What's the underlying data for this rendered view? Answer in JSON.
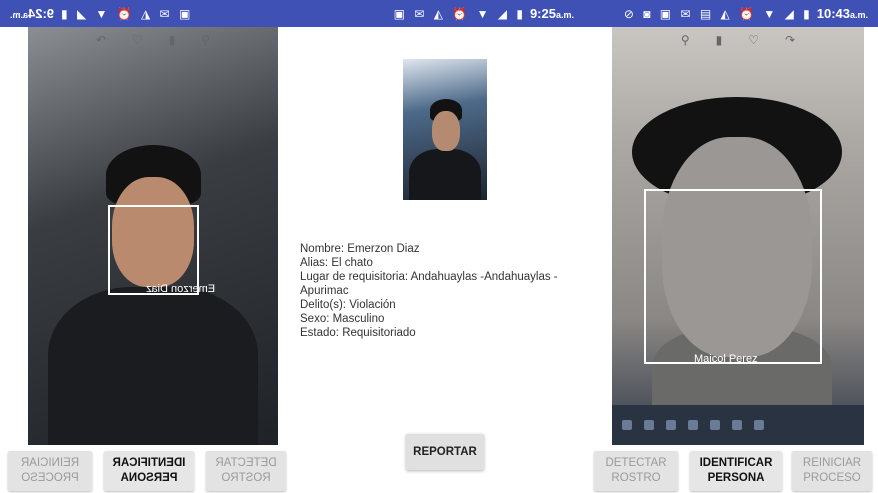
{
  "left_screen": {
    "status": {
      "time": "9:24",
      "ampm": "a.m.",
      "icons": [
        "image-icon",
        "mail-icon",
        "android-icon",
        "alarm-icon",
        "wifi-icon",
        "signal-icon",
        "battery-icon"
      ]
    },
    "camera_tools": [
      "edit-icon",
      "heart-icon",
      "trash-icon",
      "search-icon"
    ],
    "face_label": "Emerzon Diaz",
    "buttons": {
      "restart": "REINICIAR PROCESO",
      "identify": "IDENTIFICAR PERSONA",
      "detect": "DETECTAR ROSTRO"
    }
  },
  "middle_screen": {
    "status": {
      "time": "9:25",
      "ampm": "a.m.",
      "icons": [
        "image-icon",
        "mail-icon",
        "android-icon",
        "alarm-icon",
        "wifi-icon",
        "signal-icon",
        "battery-icon"
      ]
    },
    "info": {
      "nombre": "Nombre: Emerzon Diaz",
      "alias": "Alias: El chato",
      "lugar": "Lugar de requisitoria: Andahuaylas -Andahuaylas - Apurimac",
      "delito": "Delito(s): Violación",
      "sexo": "Sexo: Masculino",
      "estado": "Estado: Requisitoriado"
    },
    "report_button": "REPORTAR"
  },
  "right_screen": {
    "status": {
      "time": "10:43",
      "ampm": "a.m.",
      "icons": [
        "do-not-disturb-icon",
        "app-icon",
        "image-icon",
        "mail-icon",
        "chat-icon",
        "android-icon",
        "alarm-icon",
        "wifi-icon",
        "signal-icon",
        "battery-icon"
      ]
    },
    "camera_tools": [
      "search-icon",
      "trash-icon",
      "heart-icon",
      "edit-icon"
    ],
    "face_label": "Maicol Perez",
    "buttons": {
      "detect": "DETECTAR ROSTRO",
      "identify": "IDENTIFICAR PERSONA",
      "restart": "REINICIAR PROCESO"
    }
  }
}
